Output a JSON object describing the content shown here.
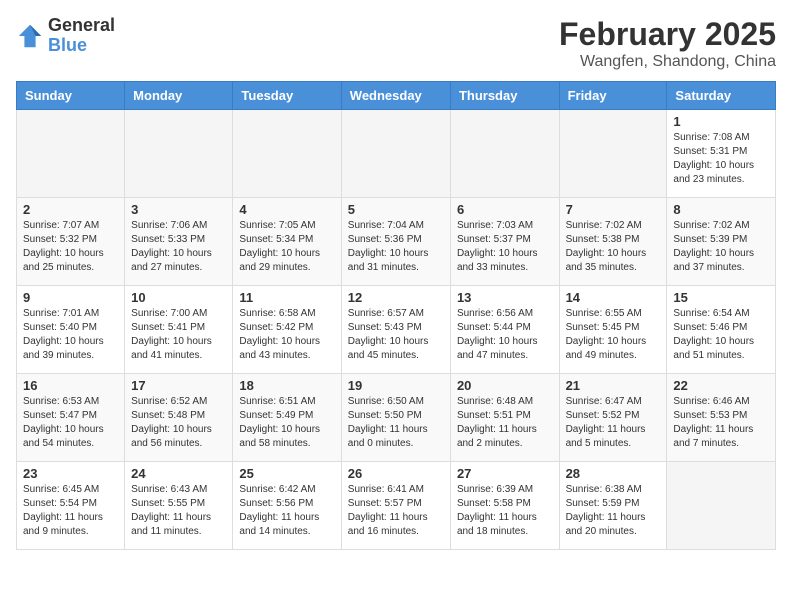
{
  "header": {
    "logo_general": "General",
    "logo_blue": "Blue",
    "month": "February 2025",
    "location": "Wangfen, Shandong, China"
  },
  "weekdays": [
    "Sunday",
    "Monday",
    "Tuesday",
    "Wednesday",
    "Thursday",
    "Friday",
    "Saturday"
  ],
  "weeks": [
    [
      {
        "day": "",
        "info": ""
      },
      {
        "day": "",
        "info": ""
      },
      {
        "day": "",
        "info": ""
      },
      {
        "day": "",
        "info": ""
      },
      {
        "day": "",
        "info": ""
      },
      {
        "day": "",
        "info": ""
      },
      {
        "day": "1",
        "info": "Sunrise: 7:08 AM\nSunset: 5:31 PM\nDaylight: 10 hours\nand 23 minutes."
      }
    ],
    [
      {
        "day": "2",
        "info": "Sunrise: 7:07 AM\nSunset: 5:32 PM\nDaylight: 10 hours\nand 25 minutes."
      },
      {
        "day": "3",
        "info": "Sunrise: 7:06 AM\nSunset: 5:33 PM\nDaylight: 10 hours\nand 27 minutes."
      },
      {
        "day": "4",
        "info": "Sunrise: 7:05 AM\nSunset: 5:34 PM\nDaylight: 10 hours\nand 29 minutes."
      },
      {
        "day": "5",
        "info": "Sunrise: 7:04 AM\nSunset: 5:36 PM\nDaylight: 10 hours\nand 31 minutes."
      },
      {
        "day": "6",
        "info": "Sunrise: 7:03 AM\nSunset: 5:37 PM\nDaylight: 10 hours\nand 33 minutes."
      },
      {
        "day": "7",
        "info": "Sunrise: 7:02 AM\nSunset: 5:38 PM\nDaylight: 10 hours\nand 35 minutes."
      },
      {
        "day": "8",
        "info": "Sunrise: 7:02 AM\nSunset: 5:39 PM\nDaylight: 10 hours\nand 37 minutes."
      }
    ],
    [
      {
        "day": "9",
        "info": "Sunrise: 7:01 AM\nSunset: 5:40 PM\nDaylight: 10 hours\nand 39 minutes."
      },
      {
        "day": "10",
        "info": "Sunrise: 7:00 AM\nSunset: 5:41 PM\nDaylight: 10 hours\nand 41 minutes."
      },
      {
        "day": "11",
        "info": "Sunrise: 6:58 AM\nSunset: 5:42 PM\nDaylight: 10 hours\nand 43 minutes."
      },
      {
        "day": "12",
        "info": "Sunrise: 6:57 AM\nSunset: 5:43 PM\nDaylight: 10 hours\nand 45 minutes."
      },
      {
        "day": "13",
        "info": "Sunrise: 6:56 AM\nSunset: 5:44 PM\nDaylight: 10 hours\nand 47 minutes."
      },
      {
        "day": "14",
        "info": "Sunrise: 6:55 AM\nSunset: 5:45 PM\nDaylight: 10 hours\nand 49 minutes."
      },
      {
        "day": "15",
        "info": "Sunrise: 6:54 AM\nSunset: 5:46 PM\nDaylight: 10 hours\nand 51 minutes."
      }
    ],
    [
      {
        "day": "16",
        "info": "Sunrise: 6:53 AM\nSunset: 5:47 PM\nDaylight: 10 hours\nand 54 minutes."
      },
      {
        "day": "17",
        "info": "Sunrise: 6:52 AM\nSunset: 5:48 PM\nDaylight: 10 hours\nand 56 minutes."
      },
      {
        "day": "18",
        "info": "Sunrise: 6:51 AM\nSunset: 5:49 PM\nDaylight: 10 hours\nand 58 minutes."
      },
      {
        "day": "19",
        "info": "Sunrise: 6:50 AM\nSunset: 5:50 PM\nDaylight: 11 hours\nand 0 minutes."
      },
      {
        "day": "20",
        "info": "Sunrise: 6:48 AM\nSunset: 5:51 PM\nDaylight: 11 hours\nand 2 minutes."
      },
      {
        "day": "21",
        "info": "Sunrise: 6:47 AM\nSunset: 5:52 PM\nDaylight: 11 hours\nand 5 minutes."
      },
      {
        "day": "22",
        "info": "Sunrise: 6:46 AM\nSunset: 5:53 PM\nDaylight: 11 hours\nand 7 minutes."
      }
    ],
    [
      {
        "day": "23",
        "info": "Sunrise: 6:45 AM\nSunset: 5:54 PM\nDaylight: 11 hours\nand 9 minutes."
      },
      {
        "day": "24",
        "info": "Sunrise: 6:43 AM\nSunset: 5:55 PM\nDaylight: 11 hours\nand 11 minutes."
      },
      {
        "day": "25",
        "info": "Sunrise: 6:42 AM\nSunset: 5:56 PM\nDaylight: 11 hours\nand 14 minutes."
      },
      {
        "day": "26",
        "info": "Sunrise: 6:41 AM\nSunset: 5:57 PM\nDaylight: 11 hours\nand 16 minutes."
      },
      {
        "day": "27",
        "info": "Sunrise: 6:39 AM\nSunset: 5:58 PM\nDaylight: 11 hours\nand 18 minutes."
      },
      {
        "day": "28",
        "info": "Sunrise: 6:38 AM\nSunset: 5:59 PM\nDaylight: 11 hours\nand 20 minutes."
      },
      {
        "day": "",
        "info": ""
      }
    ]
  ]
}
